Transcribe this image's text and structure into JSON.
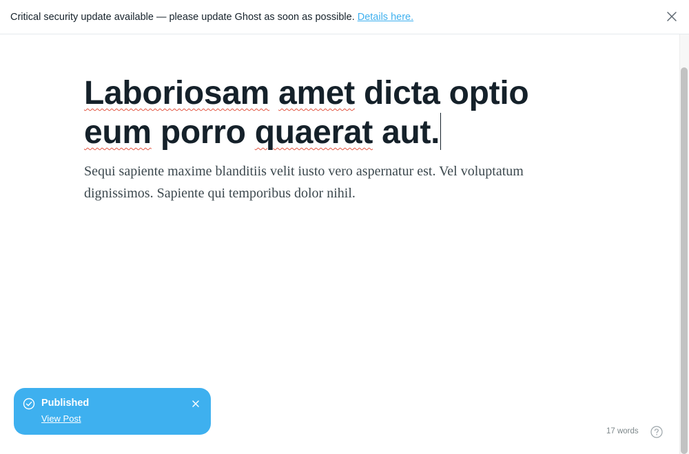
{
  "banner": {
    "message": "Critical security update available — please update Ghost as soon as possible.",
    "link_label": "Details here."
  },
  "editor": {
    "title_words": [
      "Laboriosam",
      "amet",
      "dicta",
      "optio",
      "eum",
      "porro",
      "quaerat",
      "aut."
    ],
    "body": "Sequi sapiente maxime blanditiis velit iusto vero aspernatur est. Vel voluptatum dignissimos. Sapiente qui temporibus dolor nihil."
  },
  "toast": {
    "title": "Published",
    "link_label": "View Post"
  },
  "status": {
    "word_count": "17 words"
  },
  "colors": {
    "accent": "#3eb0ef",
    "text": "#15212a",
    "spellcheck": "#e25440"
  },
  "icons": {
    "banner_close": "close-icon",
    "toast_status": "check-circle-icon",
    "toast_close": "close-icon",
    "help": "question-circle-icon"
  }
}
